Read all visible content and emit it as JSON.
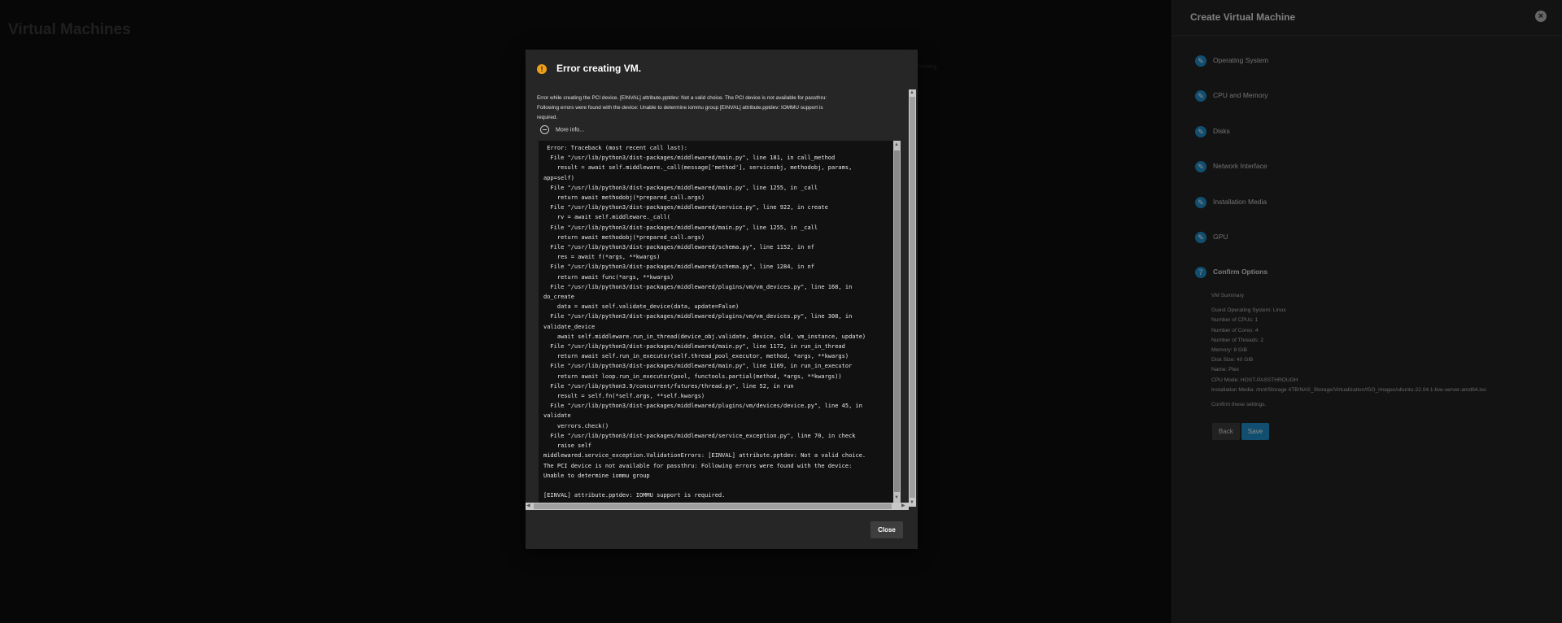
{
  "page": {
    "title": "Virtual Machines",
    "ghost_text": "running."
  },
  "panel": {
    "title": "Create Virtual Machine",
    "steps": [
      {
        "label": "Operating System",
        "icon": "pencil-icon"
      },
      {
        "label": "CPU and Memory",
        "icon": "pencil-icon"
      },
      {
        "label": "Disks",
        "icon": "pencil-icon"
      },
      {
        "label": "Network Interface",
        "icon": "pencil-icon"
      },
      {
        "label": "Installation Media",
        "icon": "pencil-icon"
      },
      {
        "label": "GPU",
        "icon": "pencil-icon"
      },
      {
        "label": "Confirm Options",
        "number": "7"
      }
    ],
    "summary": {
      "heading": "VM Summary",
      "lines": [
        "Guest Operating System: Linux",
        "Number of CPUs: 1",
        "Number of Cores: 4",
        "Number of Threads: 2",
        "Memory: 8 GiB",
        "Disk Size: 40 GiB",
        "Name: Plex",
        "CPU Mode: HOST-PASSTHROUGH",
        "Installation Media: /mnt/Storage 4TB/NAS_Storage/Virtualization/ISO_images/ubuntu-22.04.1-live-server-amd64.iso"
      ],
      "confirm": "Confirm these settings."
    },
    "back_label": "Back",
    "save_label": "Save",
    "accent_color": "#1f8ecb"
  },
  "dialog": {
    "title": "Error creating VM.",
    "message_lines": [
      "Error while creating the PCI device. [EINVAL] attribute.pptdev: Not a valid choice. The PCI device is not available for passthru:",
      "Following errors were found with the device: Unable to determine iommu group [EINVAL] attribute.pptdev: IOMMU support is",
      "required."
    ],
    "more_info_label": "More info...",
    "traceback": " Error: Traceback (most recent call last):\n  File \"/usr/lib/python3/dist-packages/middlewared/main.py\", line 181, in call_method\n    result = await self.middleware._call(message['method'], serviceobj, methodobj, params,\napp=self)\n  File \"/usr/lib/python3/dist-packages/middlewared/main.py\", line 1255, in _call\n    return await methodobj(*prepared_call.args)\n  File \"/usr/lib/python3/dist-packages/middlewared/service.py\", line 922, in create\n    rv = await self.middleware._call(\n  File \"/usr/lib/python3/dist-packages/middlewared/main.py\", line 1255, in _call\n    return await methodobj(*prepared_call.args)\n  File \"/usr/lib/python3/dist-packages/middlewared/schema.py\", line 1152, in nf\n    res = await f(*args, **kwargs)\n  File \"/usr/lib/python3/dist-packages/middlewared/schema.py\", line 1284, in nf\n    return await func(*args, **kwargs)\n  File \"/usr/lib/python3/dist-packages/middlewared/plugins/vm/vm_devices.py\", line 168, in\ndo_create\n    data = await self.validate_device(data, update=False)\n  File \"/usr/lib/python3/dist-packages/middlewared/plugins/vm/vm_devices.py\", line 308, in\nvalidate_device\n    await self.middleware.run_in_thread(device_obj.validate, device, old, vm_instance, update)\n  File \"/usr/lib/python3/dist-packages/middlewared/main.py\", line 1172, in run_in_thread\n    return await self.run_in_executor(self.thread_pool_executor, method, *args, **kwargs)\n  File \"/usr/lib/python3/dist-packages/middlewared/main.py\", line 1169, in run_in_executor\n    return await loop.run_in_executor(pool, functools.partial(method, *args, **kwargs))\n  File \"/usr/lib/python3.9/concurrent/futures/thread.py\", line 52, in run\n    result = self.fn(*self.args, **self.kwargs)\n  File \"/usr/lib/python3/dist-packages/middlewared/plugins/vm/devices/device.py\", line 45, in\nvalidate\n    verrors.check()\n  File \"/usr/lib/python3/dist-packages/middlewared/service_exception.py\", line 70, in check\n    raise self\nmiddlewared.service_exception.ValidationErrors: [EINVAL] attribute.pptdev: Not a valid choice.\nThe PCI device is not available for passthru: Following errors were found with the device:\nUnable to determine iommu group\n\n[EINVAL] attribute.pptdev: IOMMU support is required.",
    "close_label": "Close",
    "warning_color": "#f0a016"
  }
}
